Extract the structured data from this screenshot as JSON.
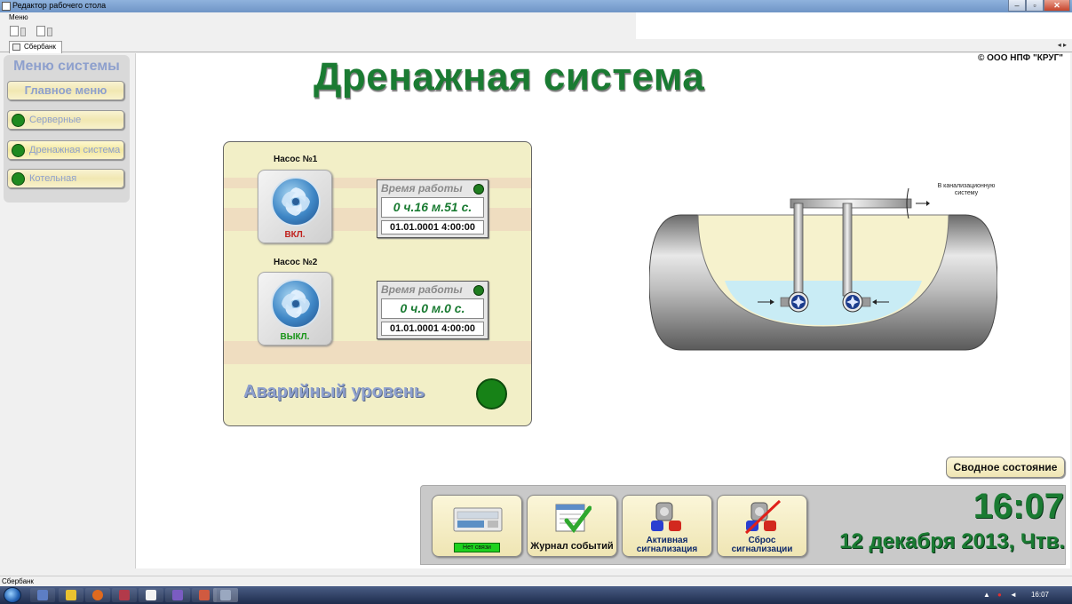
{
  "window": {
    "title": "Редактор рабочего стола",
    "menu_label": "Меню",
    "tab_label": "Сбербанк",
    "status_text": "Сбербанк"
  },
  "header": {
    "title": "Дренажная система",
    "copyright": "© ООО НПФ \"КРУГ\""
  },
  "sidebar": {
    "title": "Меню системы",
    "items": [
      {
        "label": "Главное меню",
        "has_indicator": false,
        "indicator_color": ""
      },
      {
        "label": "Серверные",
        "has_indicator": true,
        "indicator_color": "#1f8a1f"
      },
      {
        "label": "Дренажная система",
        "has_indicator": true,
        "indicator_color": "#1f8a1f"
      },
      {
        "label": "Котельная",
        "has_indicator": true,
        "indicator_color": "#1f8a1f"
      }
    ]
  },
  "pumps": [
    {
      "name": "Насос №1",
      "state": "ВКЛ.",
      "state_color": "#c0201c",
      "runtime_title": "Время работы",
      "runtime": "0 ч.16 м.51 с.",
      "datetime": "01.01.0001 4:00:00"
    },
    {
      "name": "Насос №2",
      "state": "ВЫКЛ.",
      "state_color": "#179417",
      "runtime_title": "Время работы",
      "runtime": "0 ч.0 м.0 с.",
      "datetime": "01.01.0001 4:00:00"
    }
  ],
  "alarm": {
    "label": "Аварийный уровень",
    "indicator_color": "#178217"
  },
  "tank": {
    "outlet_note": "В канализационную систему"
  },
  "bottom": {
    "summary_label": "Сводное состояние",
    "buttons": {
      "controller_status": "Нет связи",
      "event_log": "Журнал событий",
      "active_alarms": "Активная сигнализация",
      "reset_alarms": "Сброс сигнализации"
    },
    "clock": "16:07",
    "date": "12 декабря 2013, Чтв."
  },
  "taskbar": {
    "time": "16:07"
  },
  "colors": {
    "title_green": "#1a7b32",
    "menu_blue": "#8ea0cd",
    "panel_bg": "#f2efc7",
    "water": "#c9ecf5"
  }
}
